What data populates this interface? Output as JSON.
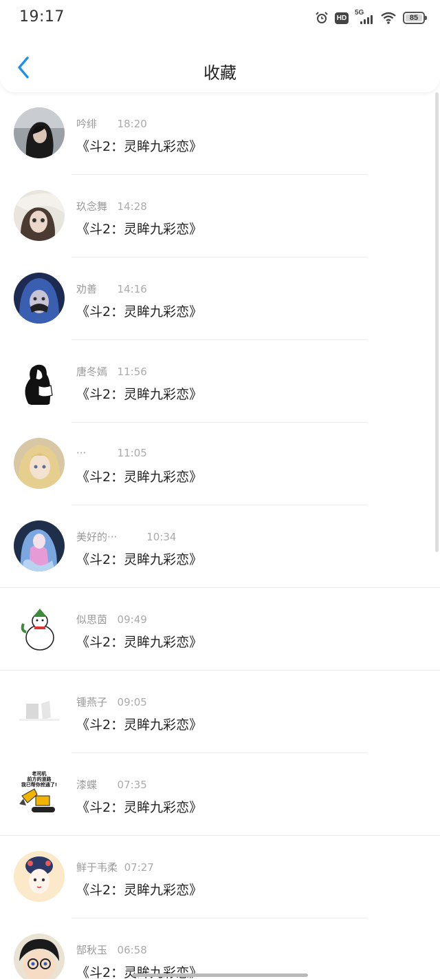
{
  "status_bar": {
    "time": "19:17",
    "network_label": "5G",
    "hd_label": "HD",
    "battery": "85",
    "icons": [
      "alarm-icon",
      "hd-icon",
      "signal-icon",
      "wifi-icon",
      "battery-icon"
    ]
  },
  "header": {
    "title": "收藏",
    "back_icon": "chevron-left-icon",
    "accent_color": "#1e90e8"
  },
  "items": [
    {
      "name": "吟绯",
      "time": "18:20",
      "title": "《斗2：灵眸九彩恋》"
    },
    {
      "name": "玖念舞",
      "time": "14:28",
      "title": "《斗2：灵眸九彩恋》"
    },
    {
      "name": "劝善",
      "time": "14:16",
      "title": "《斗2：灵眸九彩恋》"
    },
    {
      "name": "唐冬嫣",
      "time": "11:56",
      "title": "《斗2：灵眸九彩恋》"
    },
    {
      "name": "···",
      "time": "11:05",
      "title": "《斗2：灵眸九彩恋》"
    },
    {
      "name": "美好的···",
      "time": "10:34",
      "title": "《斗2：灵眸九彩恋》"
    },
    {
      "name": "似思茵",
      "time": "09:49",
      "title": "《斗2：灵眸九彩恋》"
    },
    {
      "name": "锺燕子",
      "time": "09:05",
      "title": "《斗2：灵眸九彩恋》"
    },
    {
      "name": "漆蝶",
      "time": "07:35",
      "title": "《斗2：灵眸九彩恋》",
      "avatar_text": [
        "老司机",
        "前方的道路",
        "我已帮你挖通了!"
      ]
    },
    {
      "name": "鲜于韦柔",
      "time": "07:27",
      "title": "《斗2：灵眸九彩恋》"
    },
    {
      "name": "郜秋玉",
      "time": "06:58",
      "title": "《斗2：灵眸九彩恋》"
    }
  ]
}
